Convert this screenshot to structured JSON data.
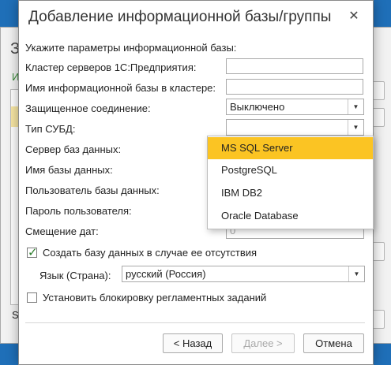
{
  "background_window": {
    "title": "З",
    "link": "И",
    "footer": "S"
  },
  "dialog": {
    "title": "Добавление информационной базы/группы",
    "close_icon": "✕",
    "hint": "Укажите параметры информационной базы:",
    "labels": {
      "cluster": "Кластер серверов 1С:Предприятия:",
      "ib_name": "Имя информационной базы в кластере:",
      "secure": "Защищенное соединение:",
      "dbms": "Тип СУБД:",
      "db_server": "Сервер баз данных:",
      "db_name": "Имя базы данных:",
      "db_user": "Пользователь базы данных:",
      "db_password": "Пароль пользователя:",
      "date_offset": "Смещение дат:"
    },
    "values": {
      "cluster": "",
      "ib_name": "",
      "secure": "Выключено",
      "dbms": "",
      "date_offset": "0"
    },
    "dbms_options": [
      "MS SQL Server",
      "PostgreSQL",
      "IBM DB2",
      "Oracle Database"
    ],
    "create_db_label": "Создать базу данных в случае ее отсутствия",
    "language_label": "Язык (Страна):",
    "language_value": "русский (Россия)",
    "block_jobs_label": "Установить блокировку регламентных заданий",
    "buttons": {
      "back": "< Назад",
      "next": "Далее >",
      "cancel": "Отмена"
    }
  }
}
